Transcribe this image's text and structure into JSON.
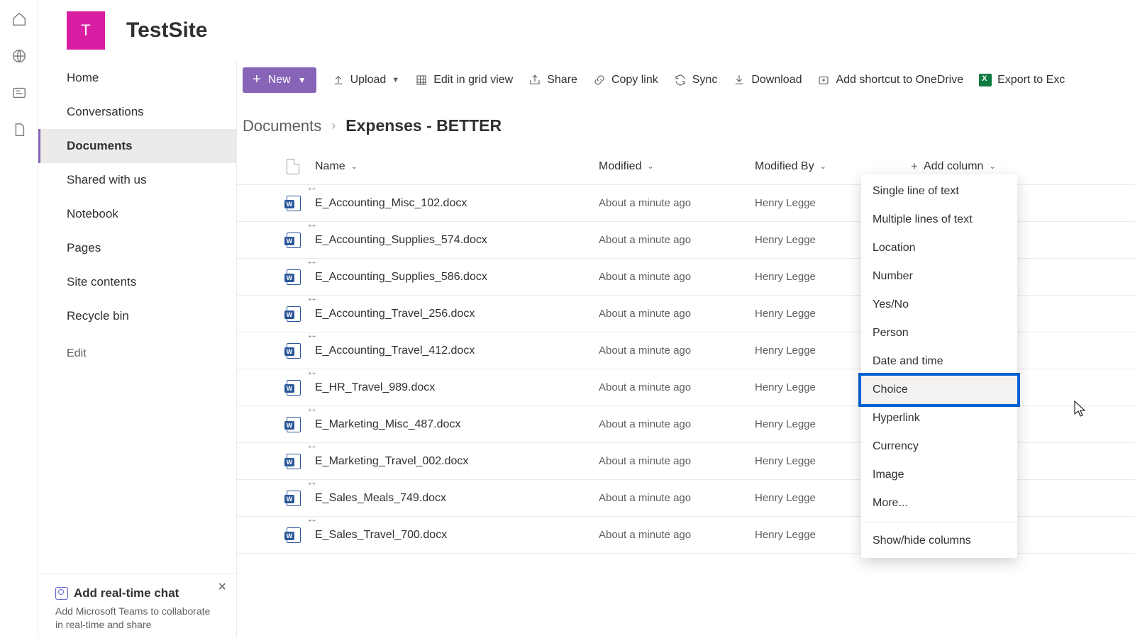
{
  "site": {
    "logo_letter": "T",
    "title": "TestSite"
  },
  "nav": {
    "items": [
      {
        "label": "Home"
      },
      {
        "label": "Conversations"
      },
      {
        "label": "Documents",
        "selected": true
      },
      {
        "label": "Shared with us"
      },
      {
        "label": "Notebook"
      },
      {
        "label": "Pages"
      },
      {
        "label": "Site contents"
      },
      {
        "label": "Recycle bin"
      }
    ],
    "edit": "Edit"
  },
  "promo": {
    "title": "Add real-time chat",
    "body": "Add Microsoft Teams to collaborate in real-time and share"
  },
  "toolbar": {
    "new": "New",
    "upload": "Upload",
    "grid": "Edit in grid view",
    "share": "Share",
    "copylink": "Copy link",
    "sync": "Sync",
    "download": "Download",
    "shortcut": "Add shortcut to OneDrive",
    "export": "Export to Exc"
  },
  "breadcrumb": {
    "root": "Documents",
    "current": "Expenses - BETTER"
  },
  "columns": {
    "name": "Name",
    "modified": "Modified",
    "modified_by": "Modified By",
    "add": "Add column"
  },
  "rows": [
    {
      "name": "E_Accounting_Misc_102.docx",
      "mod": "About a minute ago",
      "by": "Henry Legge"
    },
    {
      "name": "E_Accounting_Supplies_574.docx",
      "mod": "About a minute ago",
      "by": "Henry Legge"
    },
    {
      "name": "E_Accounting_Supplies_586.docx",
      "mod": "About a minute ago",
      "by": "Henry Legge"
    },
    {
      "name": "E_Accounting_Travel_256.docx",
      "mod": "About a minute ago",
      "by": "Henry Legge"
    },
    {
      "name": "E_Accounting_Travel_412.docx",
      "mod": "About a minute ago",
      "by": "Henry Legge"
    },
    {
      "name": "E_HR_Travel_989.docx",
      "mod": "About a minute ago",
      "by": "Henry Legge"
    },
    {
      "name": "E_Marketing_Misc_487.docx",
      "mod": "About a minute ago",
      "by": "Henry Legge"
    },
    {
      "name": "E_Marketing_Travel_002.docx",
      "mod": "About a minute ago",
      "by": "Henry Legge"
    },
    {
      "name": "E_Sales_Meals_749.docx",
      "mod": "About a minute ago",
      "by": "Henry Legge"
    },
    {
      "name": "E_Sales_Travel_700.docx",
      "mod": "About a minute ago",
      "by": "Henry Legge"
    }
  ],
  "addColumnMenu": [
    "Single line of text",
    "Multiple lines of text",
    "Location",
    "Number",
    "Yes/No",
    "Person",
    "Date and time",
    "Choice",
    "Hyperlink",
    "Currency",
    "Image",
    "More...",
    "Show/hide columns"
  ],
  "highlightedMenuItem": "Choice"
}
